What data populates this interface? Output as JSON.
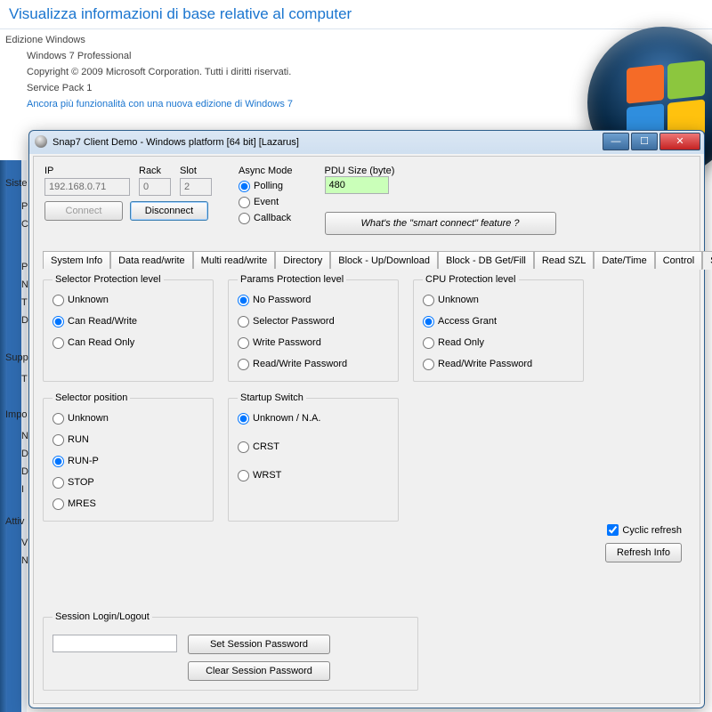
{
  "sysinfo": {
    "title": "Visualizza informazioni di base relative al computer",
    "section_heading": "Edizione Windows",
    "line1": "Windows 7 Professional",
    "line2": "Copyright © 2009 Microsoft Corporation. Tutti i diritti riservati.",
    "line3": "Service Pack 1",
    "link": "Ancora più funzionalità con una nuova edizione di Windows 7"
  },
  "side": {
    "l1": "Siste",
    "l2": "P",
    "l3": "C",
    "l4": "P",
    "l5": "N",
    "l6": "T",
    "l7": "D",
    "l8": "Supp",
    "l9": "T",
    "l10": "Impo",
    "l11": "N",
    "l12": "D",
    "l13": "D",
    "l14": "I",
    "l15": "Attiv",
    "l16": "V",
    "l17": "N"
  },
  "win": {
    "title": "Snap7 Client Demo - Windows platform [64 bit] [Lazarus]",
    "top": {
      "ip_label": "IP",
      "ip_value": "192.168.0.71",
      "rack_label": "Rack",
      "rack_value": "0",
      "slot_label": "Slot",
      "slot_value": "2",
      "connect": "Connect",
      "disconnect": "Disconnect",
      "async_label": "Async Mode",
      "async": {
        "polling": "Polling",
        "event": "Event",
        "callback": "Callback"
      },
      "pdu_label": "PDU Size (byte)",
      "pdu_value": "480",
      "smart": "What's the \"smart connect\" feature ?"
    },
    "tabs": [
      "System Info",
      "Data read/write",
      "Multi read/write",
      "Directory",
      "Block - Up/Download",
      "Block - DB Get/Fill",
      "Read SZL",
      "Date/Time",
      "Control",
      "Security"
    ],
    "sec": {
      "sel_prot": {
        "legend": "Selector Protection level",
        "o1": "Unknown",
        "o2": "Can Read/Write",
        "o3": "Can Read Only"
      },
      "par_prot": {
        "legend": "Params Protection level",
        "o1": "No Password",
        "o2": "Selector Password",
        "o3": "Write Password",
        "o4": "Read/Write Password"
      },
      "cpu_prot": {
        "legend": "CPU Protection level",
        "o1": "Unknown",
        "o2": "Access Grant",
        "o3": "Read Only",
        "o4": "Read/Write Password"
      },
      "sel_pos": {
        "legend": "Selector position",
        "o1": "Unknown",
        "o2": "RUN",
        "o3": "RUN-P",
        "o4": "STOP",
        "o5": "MRES"
      },
      "startup": {
        "legend": "Startup Switch",
        "o1": "Unknown / N.A.",
        "o2": "CRST",
        "o3": "WRST"
      },
      "cyclic": "Cyclic refresh",
      "refresh": "Refresh Info",
      "sess_legend": "Session Login/Logout",
      "set_pw": "Set Session Password",
      "clr_pw": "Clear Session Password"
    }
  }
}
